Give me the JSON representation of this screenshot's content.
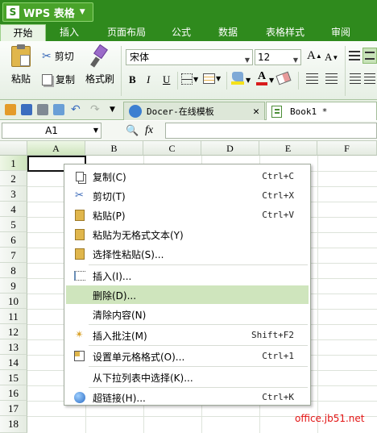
{
  "app": {
    "title": "WPS 表格",
    "logo": "S"
  },
  "ribbon_tabs": [
    "开始",
    "插入",
    "页面布局",
    "公式",
    "数据",
    "表格样式",
    "审阅"
  ],
  "ribbon": {
    "paste": "粘贴",
    "cut": "剪切",
    "copy": "复制",
    "format_painter": "格式刷",
    "font_name": "宋体",
    "font_size": "12",
    "bold": "B",
    "italic": "I",
    "underline": "U",
    "grow_font": "A",
    "shrink_font": "A"
  },
  "docs": {
    "tab1": "Docer-在线模板",
    "tab2": "Book1 *"
  },
  "formula_bar": {
    "cell_ref": "A1",
    "fx": "fx"
  },
  "columns": [
    "A",
    "B",
    "C",
    "D",
    "E",
    "F"
  ],
  "rows": [
    "1",
    "2",
    "3",
    "4",
    "5",
    "6",
    "7",
    "8",
    "9",
    "10",
    "11",
    "12",
    "13",
    "14",
    "15",
    "16",
    "17",
    "18"
  ],
  "context_menu": {
    "items": [
      {
        "label": "复制(C)",
        "shortcut": "Ctrl+C",
        "icon": "copy-icon"
      },
      {
        "label": "剪切(T)",
        "shortcut": "Ctrl+X",
        "icon": "scissors-icon"
      },
      {
        "label": "粘贴(P)",
        "shortcut": "Ctrl+V",
        "icon": "paste-icon"
      },
      {
        "label": "粘贴为无格式文本(Y)",
        "shortcut": "",
        "icon": "paste-text-icon"
      },
      {
        "label": "选择性粘贴(S)...",
        "shortcut": "",
        "icon": "paste-special-icon"
      },
      {
        "label": "插入(I)...",
        "shortcut": "",
        "icon": "insert-icon"
      },
      {
        "label": "删除(D)...",
        "shortcut": "",
        "icon": ""
      },
      {
        "label": "清除内容(N)",
        "shortcut": "",
        "icon": ""
      },
      {
        "label": "插入批注(M)",
        "shortcut": "Shift+F2",
        "icon": "comment-icon"
      },
      {
        "label": "设置单元格格式(O)...",
        "shortcut": "Ctrl+1",
        "icon": "format-cells-icon"
      },
      {
        "label": "从下拉列表中选择(K)...",
        "shortcut": "",
        "icon": ""
      },
      {
        "label": "超链接(H)...",
        "shortcut": "Ctrl+K",
        "icon": "hyperlink-icon"
      }
    ]
  },
  "watermark": "office.jb51.net",
  "colors": {
    "green": "#2f8a1d",
    "highlight": "#cfe5bd",
    "watermark": "#e31414"
  }
}
